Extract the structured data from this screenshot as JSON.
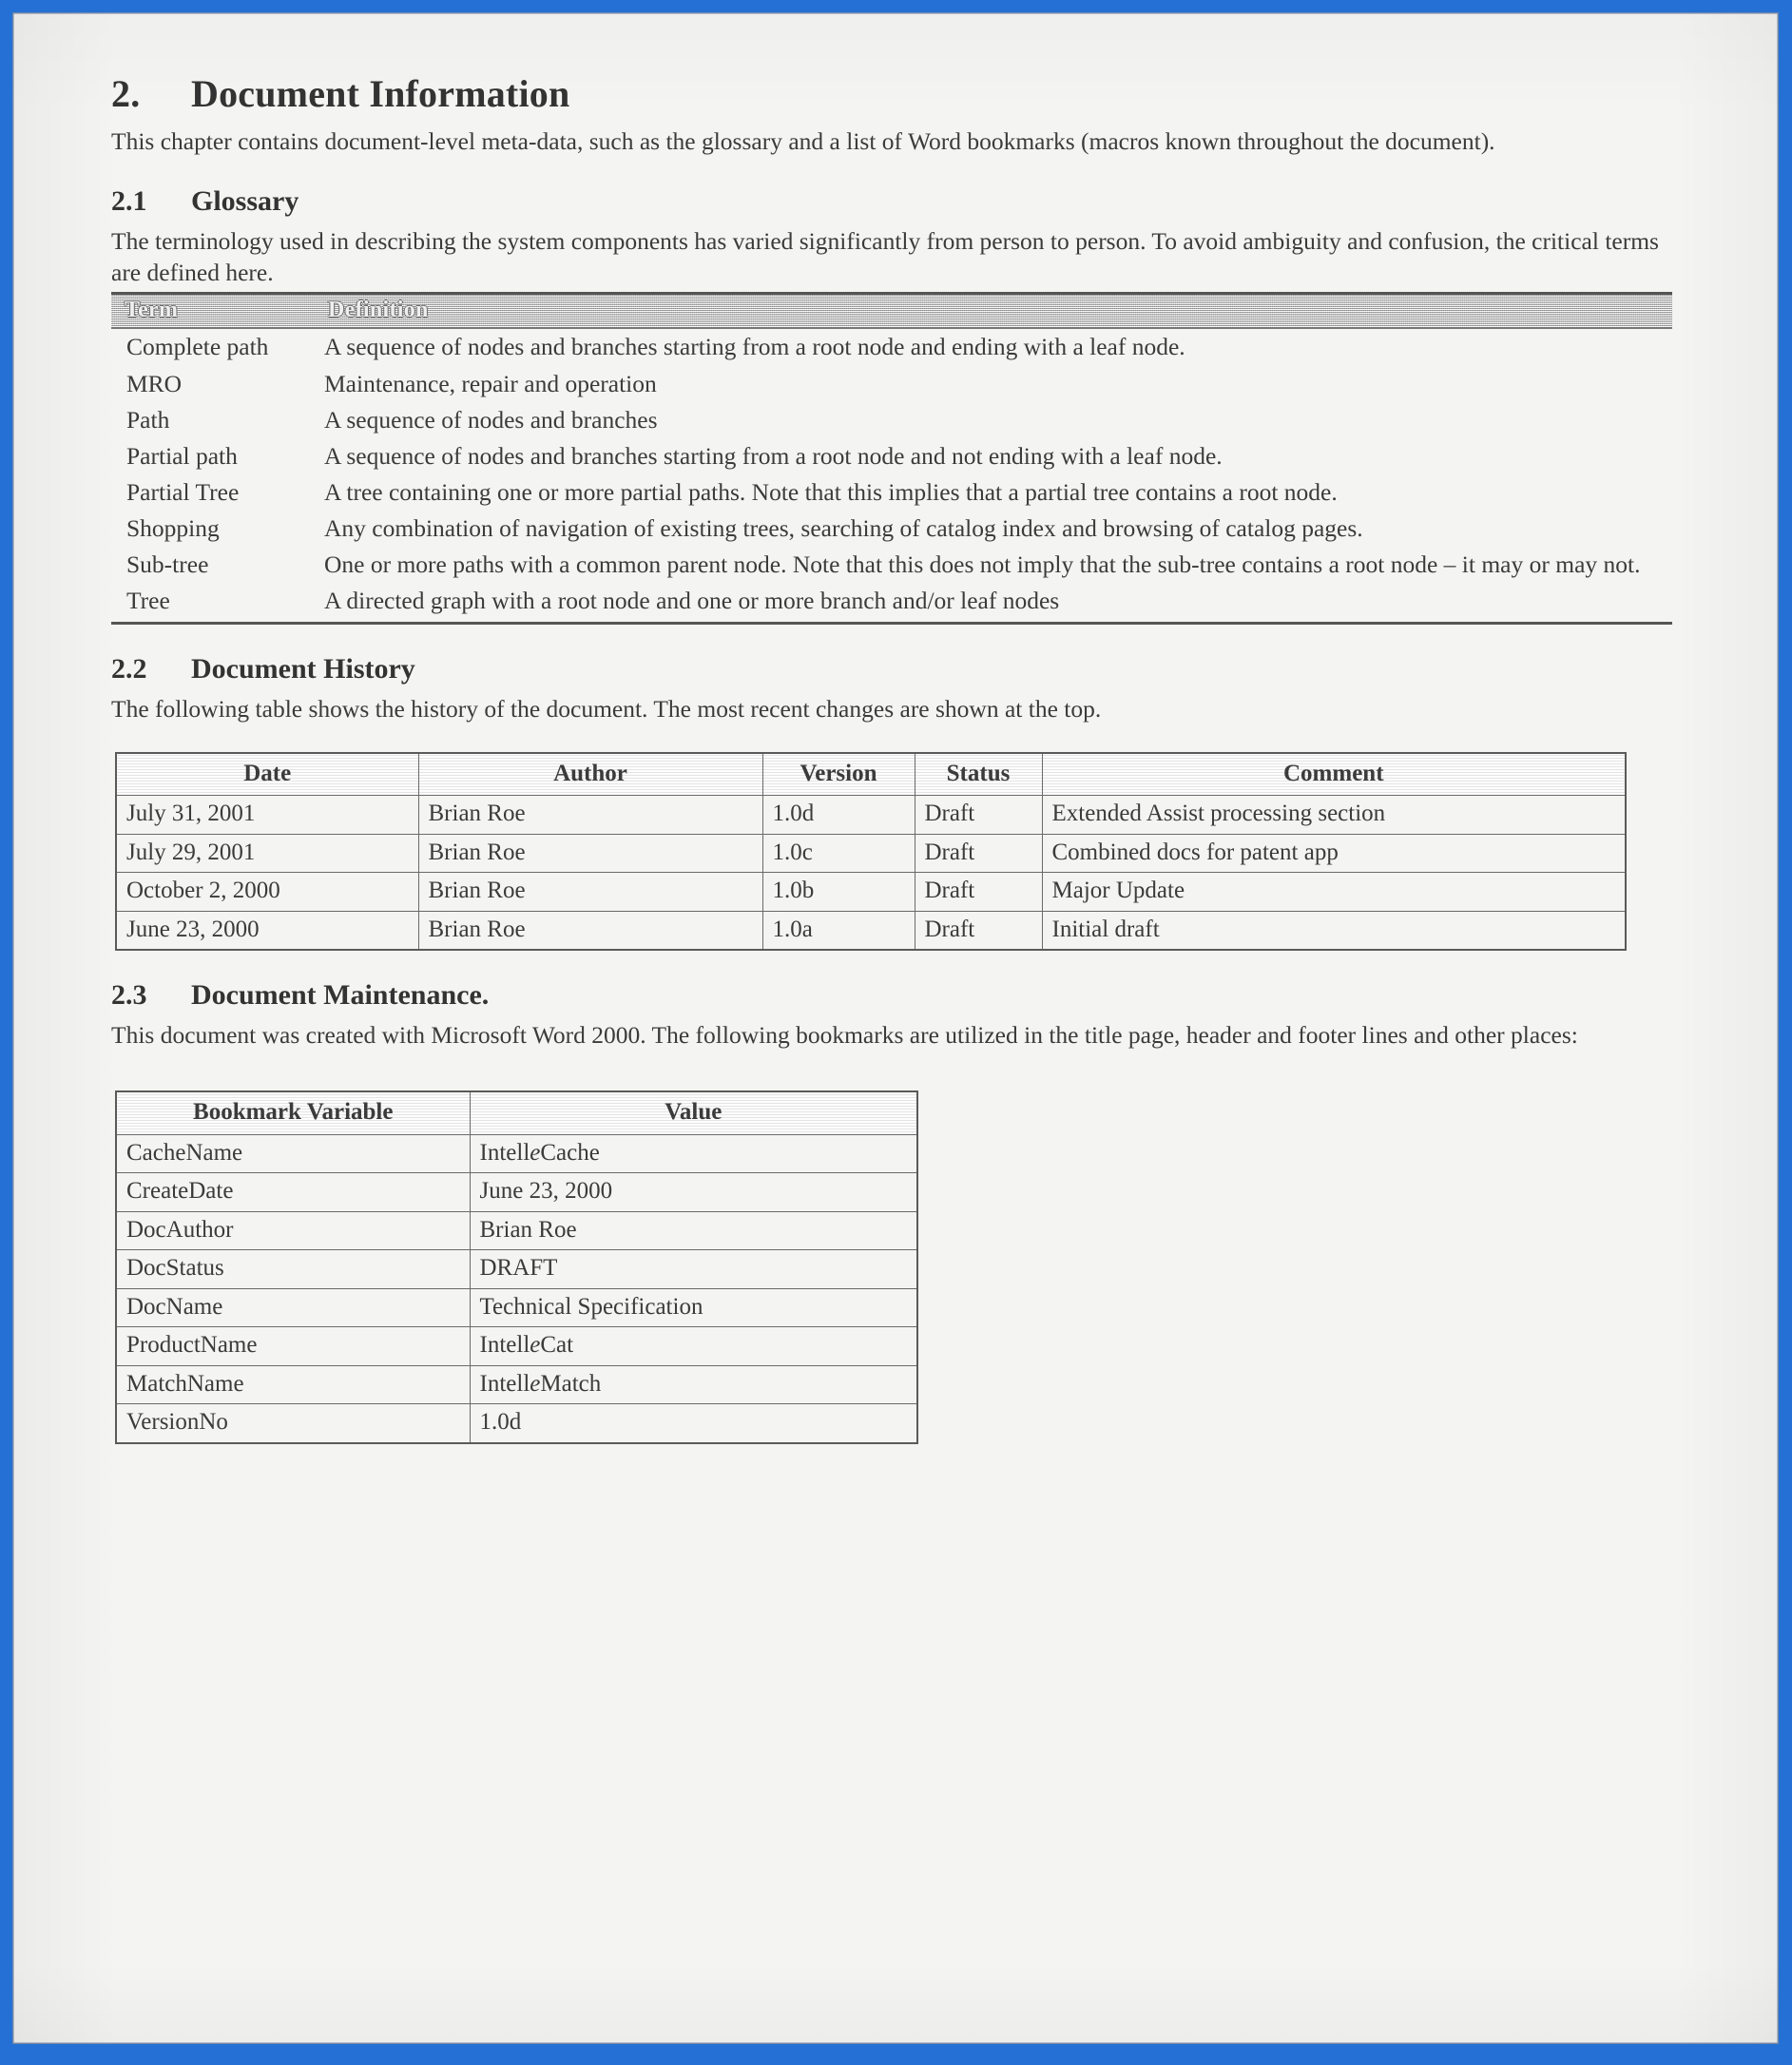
{
  "page": {
    "border_color": "#2570d4",
    "paper_color": "#f4f4f2",
    "ink_color": "#3b3b3b"
  },
  "chapter": {
    "number": "2.",
    "title": "Document Information",
    "intro": "This chapter contains document-level meta-data, such as the glossary and a list of Word bookmarks (macros known throughout the document)."
  },
  "glossary_section": {
    "number": "2.1",
    "title": "Glossary",
    "intro": "The terminology used in describing the system components has varied significantly from person to person.  To avoid ambiguity and confusion, the critical terms are defined here.",
    "columns": [
      "Term",
      "Definition"
    ],
    "rows": [
      {
        "term": "Complete path",
        "definition": "A sequence of nodes and branches starting from a root node and ending with a leaf node."
      },
      {
        "term": "MRO",
        "definition": "Maintenance, repair and operation"
      },
      {
        "term": "Path",
        "definition": "A sequence of nodes and branches"
      },
      {
        "term": "Partial path",
        "definition": "A sequence of nodes and branches starting from a root node and not ending with a leaf node."
      },
      {
        "term": "Partial Tree",
        "definition": "A tree containing one or more partial paths.  Note that this implies that a partial tree contains a root node."
      },
      {
        "term": "Shopping",
        "definition": "Any combination of navigation of existing trees, searching of catalog index and browsing of catalog pages."
      },
      {
        "term": "Sub-tree",
        "definition": "One or more paths with a common parent node.  Note that this does not imply that the sub-tree contains a root node – it may or may not."
      },
      {
        "term": "Tree",
        "definition": "A directed graph with a root node and one or more branch and/or leaf nodes"
      }
    ]
  },
  "history_section": {
    "number": "2.2",
    "title": "Document History",
    "intro": "The following table shows the history of the document.  The most recent changes are shown at the top.",
    "columns": [
      "Date",
      "Author",
      "Version",
      "Status",
      "Comment"
    ],
    "rows": [
      {
        "date": "July 31, 2001",
        "author": "Brian Roe",
        "version": "1.0d",
        "status": "Draft",
        "comment": "Extended Assist processing section"
      },
      {
        "date": "July 29, 2001",
        "author": "Brian Roe",
        "version": "1.0c",
        "status": "Draft",
        "comment": "Combined docs for patent app"
      },
      {
        "date": "October 2, 2000",
        "author": "Brian Roe",
        "version": "1.0b",
        "status": "Draft",
        "comment": "Major Update"
      },
      {
        "date": "June 23, 2000",
        "author": "Brian Roe",
        "version": "1.0a",
        "status": "Draft",
        "comment": "Initial draft"
      }
    ]
  },
  "maintenance_section": {
    "number": "2.3",
    "title": "Document Maintenance.",
    "intro": "This document was created with Microsoft Word 2000. The following bookmarks are utilized in the title page, header and footer lines and other places:",
    "columns": [
      "Bookmark Variable",
      "Value"
    ],
    "rows": [
      {
        "variable": "CacheName",
        "value": "IntelleCache",
        "value_pre": "Intell",
        "value_italic": "e",
        "value_post": "Cache"
      },
      {
        "variable": "CreateDate",
        "value": "June 23, 2000",
        "value_pre": "June 23, 2000",
        "value_italic": "",
        "value_post": ""
      },
      {
        "variable": "DocAuthor",
        "value": "Brian Roe",
        "value_pre": "Brian Roe",
        "value_italic": "",
        "value_post": ""
      },
      {
        "variable": "DocStatus",
        "value": "DRAFT",
        "value_pre": "DRAFT",
        "value_italic": "",
        "value_post": ""
      },
      {
        "variable": "DocName",
        "value": "Technical Specification",
        "value_pre": "Technical Specification",
        "value_italic": "",
        "value_post": ""
      },
      {
        "variable": "ProductName",
        "value": "IntelleCat",
        "value_pre": "Intell",
        "value_italic": "e",
        "value_post": "Cat"
      },
      {
        "variable": "MatchName",
        "value": "IntelleMatch",
        "value_pre": "Intell",
        "value_italic": "e",
        "value_post": "Match"
      },
      {
        "variable": "VersionNo",
        "value": "1.0d",
        "value_pre": "1.0d",
        "value_italic": "",
        "value_post": ""
      }
    ]
  }
}
